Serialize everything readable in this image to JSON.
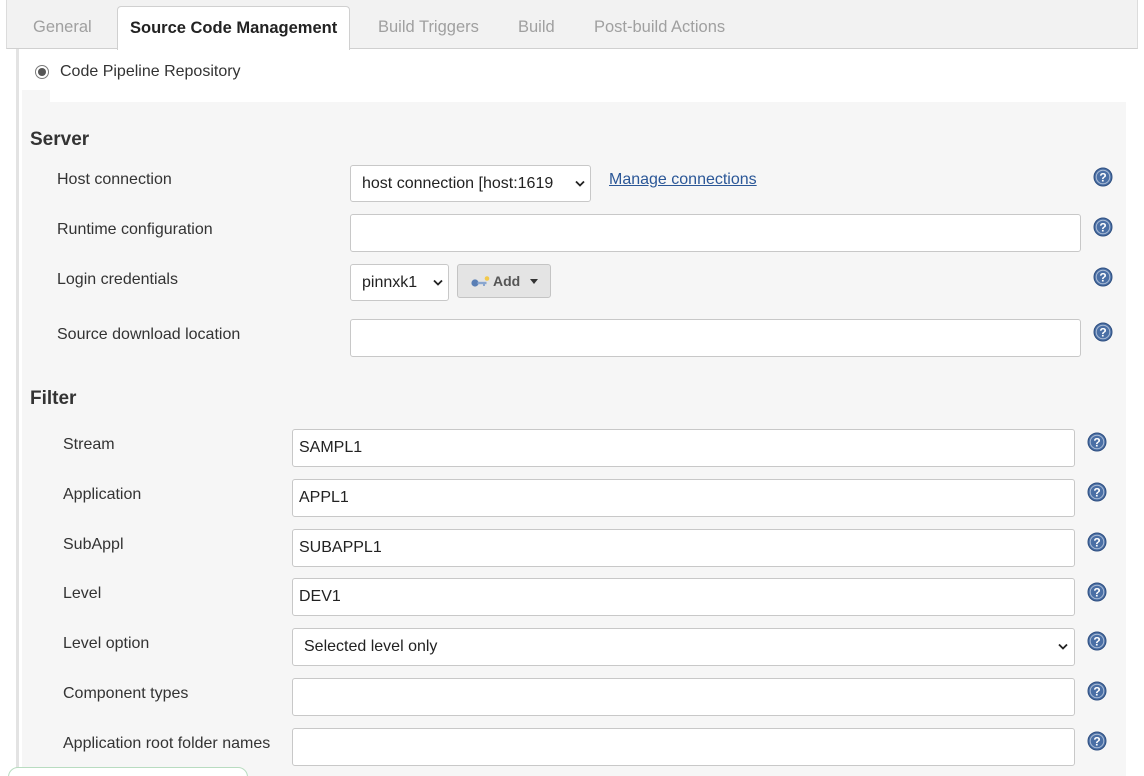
{
  "tabs": [
    {
      "label": "General",
      "active": false
    },
    {
      "label": "Source Code Management",
      "active": true
    },
    {
      "label": "Build Triggers",
      "active": false
    },
    {
      "label": "Build",
      "active": false
    },
    {
      "label": "Post-build Actions",
      "active": false
    }
  ],
  "scm": {
    "option_label": "Code Pipeline Repository",
    "selected": true
  },
  "server": {
    "heading": "Server",
    "host_connection": {
      "label": "Host connection",
      "value": "host connection [host:1619",
      "link": "Manage connections"
    },
    "runtime_configuration": {
      "label": "Runtime configuration",
      "value": ""
    },
    "login_credentials": {
      "label": "Login credentials",
      "value": "pinnxk1",
      "add_label": "Add"
    },
    "source_download_location": {
      "label": "Source download location",
      "value": ""
    }
  },
  "filter": {
    "heading": "Filter",
    "stream": {
      "label": "Stream",
      "value": "SAMPL1"
    },
    "application": {
      "label": "Application",
      "value": "APPL1"
    },
    "subappl": {
      "label": "SubAppl",
      "value": "SUBAPPL1"
    },
    "level": {
      "label": "Level",
      "value": "DEV1"
    },
    "level_option": {
      "label": "Level option",
      "value": "Selected level only"
    },
    "component_types": {
      "label": "Component types",
      "value": ""
    },
    "app_root_folder_names": {
      "label": "Application root folder names",
      "value": ""
    }
  },
  "colors": {
    "link": "#2b5797",
    "help_icon": "#4a6fa5",
    "tab_bar": "#f2f2f2",
    "panel": "#f6f6f6"
  },
  "icons": {
    "help": "help-icon",
    "key": "key-icon",
    "select_arrow": "chevron-down-icon"
  }
}
